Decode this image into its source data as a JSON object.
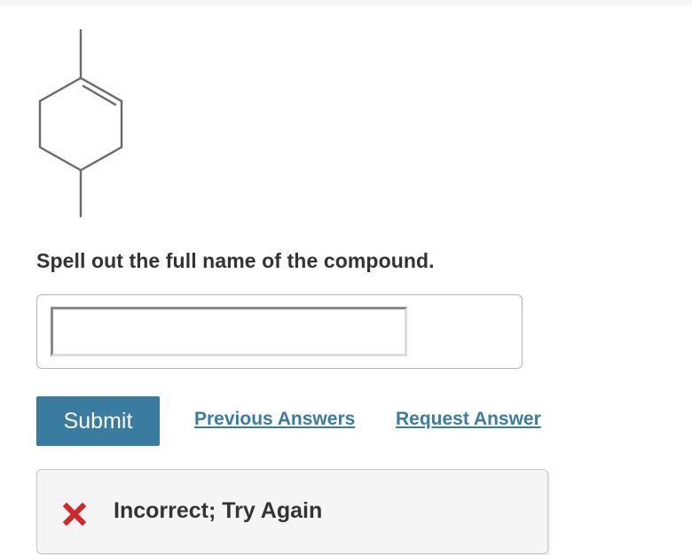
{
  "question": {
    "structure_label": "1,4-dimethylcyclohexene skeletal structure",
    "prompt": "Spell out the full name of the compound."
  },
  "answer": {
    "value": "",
    "placeholder": ""
  },
  "actions": {
    "submit_label": "Submit",
    "previous_answers_label": "Previous Answers",
    "request_answer_label": "Request Answer"
  },
  "feedback": {
    "icon": "x-mark-icon",
    "text": "Incorrect; Try Again"
  },
  "colors": {
    "accent": "#3a7ca0",
    "error": "#d0262c",
    "text": "#333333"
  }
}
